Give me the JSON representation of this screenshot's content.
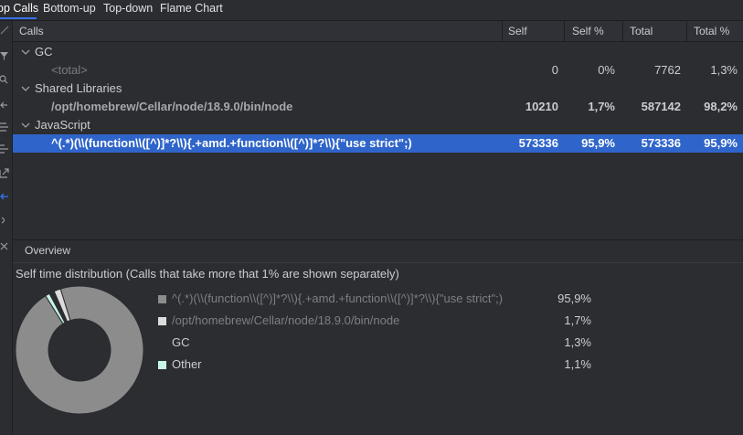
{
  "tabs": [
    {
      "label": "op Calls",
      "active": true
    },
    {
      "label": "Bottom-up",
      "active": false
    },
    {
      "label": "Top-down",
      "active": false
    },
    {
      "label": "Flame Chart",
      "active": false
    }
  ],
  "toolbar_icons": [
    "collapse-icon",
    "filter-icon",
    "search-icon",
    "arrow-left-icon",
    "expand-all-icon",
    "collapse-all-icon",
    "export-icon",
    "back-icon",
    "settings-icon",
    "close-icon"
  ],
  "table": {
    "headers": {
      "calls": "Calls",
      "self": "Self",
      "self_pct": "Self %",
      "total": "Total",
      "total_pct": "Total %"
    },
    "rows": [
      {
        "name": "GC",
        "group": true
      },
      {
        "name": "<total>",
        "self": "0",
        "self_pct": "0%",
        "total": "7762",
        "total_pct": "1,3%"
      },
      {
        "name": "Shared Libraries",
        "group": true
      },
      {
        "name": "/opt/homebrew/Cellar/node/18.9.0/bin/node",
        "self": "10210",
        "self_pct": "1,7%",
        "total": "587142",
        "total_pct": "98,2%"
      },
      {
        "name": "JavaScript",
        "group": true
      },
      {
        "name": "^(.*)(\\\\(function\\\\([^)]*?\\\\){.+amd.+function\\\\([^)]*?\\\\){\"use strict\";)",
        "self": "573336",
        "self_pct": "95,9%",
        "total": "573336",
        "total_pct": "95,9%",
        "selected": true
      }
    ]
  },
  "overview": {
    "label": "Overview",
    "title": "Self time distribution (Calls that take more that 1% are shown separately)",
    "legend": [
      {
        "name": "^(.*)(\\\\(function\\\\([^)]*?\\\\){.+amd.+function\\\\([^)]*?\\\\){\"use strict\";)",
        "pct": "95,9%",
        "color": "#8c8c8c"
      },
      {
        "name": "/opt/homebrew/Cellar/node/18.9.0/bin/node",
        "pct": "1,7%",
        "color": "#dcdcdc"
      },
      {
        "name": "GC",
        "pct": "1,3%",
        "color": "#2b2d30"
      },
      {
        "name": "Other",
        "pct": "1,1%",
        "color": "#c8f5e6"
      }
    ],
    "slices": [
      {
        "label": "^(.*)(\\\\(function\\\\([^)]*?\\\\){.+amd.+function\\\\([^)]*?\\\\){\"use strict\";)",
        "value": 95.9,
        "color": "#8c8c8c"
      },
      {
        "label": "/opt/homebrew/Cellar/node/18.9.0/bin/node",
        "value": 1.7,
        "color": "#dcdcdc"
      },
      {
        "label": "GC",
        "value": 1.3,
        "color": "#2b2d30"
      },
      {
        "label": "Other",
        "value": 1.1,
        "color": "#c8f5e6"
      }
    ]
  }
}
